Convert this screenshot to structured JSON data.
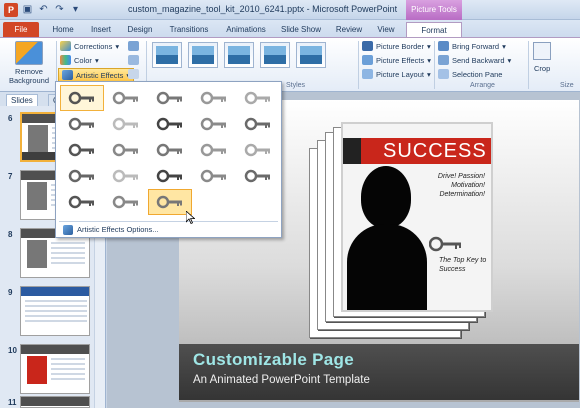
{
  "window": {
    "title": "custom_magazine_tool_kit_2010_6241.pptx - Microsoft PowerPoint",
    "app_icon": "P",
    "contextual_group": "Picture Tools"
  },
  "quick_access": [
    "save-icon",
    "undo-icon",
    "redo-icon",
    "customize-icon"
  ],
  "tabs": [
    "File",
    "Home",
    "Insert",
    "Design",
    "Transitions",
    "Animations",
    "Slide Show",
    "Review",
    "View",
    "Format"
  ],
  "ribbon": {
    "remove_background": "Remove Background",
    "corrections": "Corrections",
    "color": "Color",
    "artistic_effects": "Artistic Effects",
    "picture_border": "Picture Border",
    "picture_effects": "Picture Effects",
    "picture_layout": "Picture Layout",
    "bring_forward": "Bring Forward",
    "send_backward": "Send Backward",
    "selection_pane": "Selection Pane",
    "crop": "Crop",
    "groups": {
      "styles": "Styles",
      "arrange": "Arrange",
      "size": "Size"
    }
  },
  "left_pane": {
    "tabs": [
      "Slides",
      "O"
    ],
    "slides": [
      {
        "num": "6",
        "selected": true
      },
      {
        "num": "7"
      },
      {
        "num": "8"
      },
      {
        "num": "9"
      },
      {
        "num": "10"
      },
      {
        "num": "11"
      }
    ]
  },
  "dropdown": {
    "option": "Artistic Effects Options...",
    "effects_count": 23,
    "selected_index": 0,
    "hover_index": 22
  },
  "slide": {
    "cover_word": "SUCCESS",
    "cover_tagline": "Drive! Passion! Motivation! Determination!",
    "cover_key_text": "The Top Key to Success",
    "caption_title": "Customizable Page",
    "caption_subtitle": "An Animated PowerPoint Template"
  },
  "colors": {
    "file_tab": "#d24726",
    "picture_tools": "#b86cc4",
    "caption_title": "#9fe6e6",
    "cover_red": "#c9261b"
  }
}
